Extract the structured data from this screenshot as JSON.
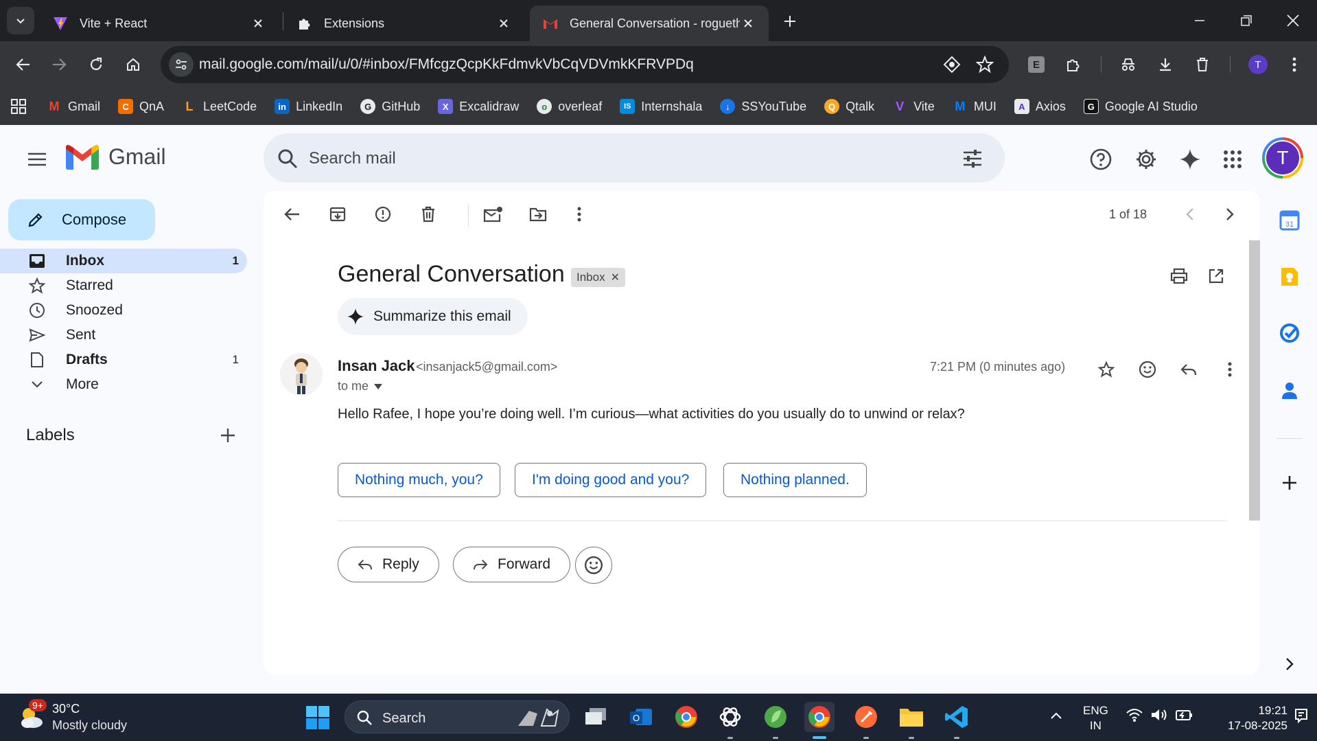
{
  "browser": {
    "tabs": [
      {
        "title": "Vite + React",
        "icon": "vite-icon"
      },
      {
        "title": "Extensions",
        "icon": "puzzle-icon"
      },
      {
        "title": "General Conversation - rogueth",
        "icon": "gmail-icon",
        "active": true
      }
    ],
    "url": "mail.google.com/mail/u/0/#inbox/FMfcgzQcpKkFdmvkVbCqVDVmkKFRVPDq",
    "profile_initial": "T",
    "extension_letter": "E",
    "bookmarks": [
      {
        "label": "Gmail",
        "color": "#ea4335",
        "glyph": "M"
      },
      {
        "label": "QnA",
        "color": "#f46d00",
        "glyph": "C"
      },
      {
        "label": "LeetCode",
        "color": "#2d2d2d",
        "glyph": "L"
      },
      {
        "label": "LinkedIn",
        "color": "#0a66c2",
        "glyph": "in"
      },
      {
        "label": "GitHub",
        "color": "#2d2d2d",
        "glyph": "G"
      },
      {
        "label": "Excalidraw",
        "color": "#6965db",
        "glyph": "X"
      },
      {
        "label": "overleaf",
        "color": "#2d2d2d",
        "glyph": "o"
      },
      {
        "label": "Internshala",
        "color": "#008bdc",
        "glyph": "IS"
      },
      {
        "label": "SSYouTube",
        "color": "#1a73e8",
        "glyph": "↓"
      },
      {
        "label": "Qtalk",
        "color": "#f9a825",
        "glyph": "Q"
      },
      {
        "label": "Vite",
        "color": "#9a5cf7",
        "glyph": "V"
      },
      {
        "label": "MUI",
        "color": "#007fff",
        "glyph": "M"
      },
      {
        "label": "Axios",
        "color": "#5a29e4",
        "glyph": "A"
      },
      {
        "label": "Google AI Studio",
        "color": "#111111",
        "glyph": "G"
      }
    ]
  },
  "gmail": {
    "product": "Gmail",
    "search_placeholder": "Search mail",
    "compose_label": "Compose",
    "nav": [
      {
        "label": "Inbox",
        "count": "1",
        "icon": "inbox-icon",
        "active": true
      },
      {
        "label": "Starred",
        "count": "",
        "icon": "star-icon"
      },
      {
        "label": "Snoozed",
        "count": "",
        "icon": "clock-icon"
      },
      {
        "label": "Sent",
        "count": "",
        "icon": "send-icon"
      },
      {
        "label": "Drafts",
        "count": "1",
        "icon": "draft-icon",
        "bold": true
      },
      {
        "label": "More",
        "count": "",
        "icon": "chevron-down-icon"
      }
    ],
    "labels_title": "Labels",
    "pager": "1 of 18",
    "subject": "General Conversation",
    "chip_label": "Inbox",
    "summarize_label": "Summarize this email",
    "sender": {
      "name": "Insan Jack",
      "email": "<insanjack5@gmail.com>",
      "to": "to me",
      "time": "7:21 PM (0 minutes ago)"
    },
    "body": "Hello Rafee, I hope you’re doing well. I’m curious—what activities do you usually do to unwind or relax?",
    "smart_replies": [
      "Nothing much, you?",
      "I'm doing good and you?",
      "Nothing planned."
    ],
    "reply_label": "Reply",
    "forward_label": "Forward",
    "profile_initial": "T"
  },
  "taskbar": {
    "weather_badge": "9+",
    "temperature": "30°C",
    "condition": "Mostly cloudy",
    "search_label": "Search",
    "lang_line1": "ENG",
    "lang_line2": "IN",
    "time": "19:21",
    "date": "17-08-2025"
  }
}
